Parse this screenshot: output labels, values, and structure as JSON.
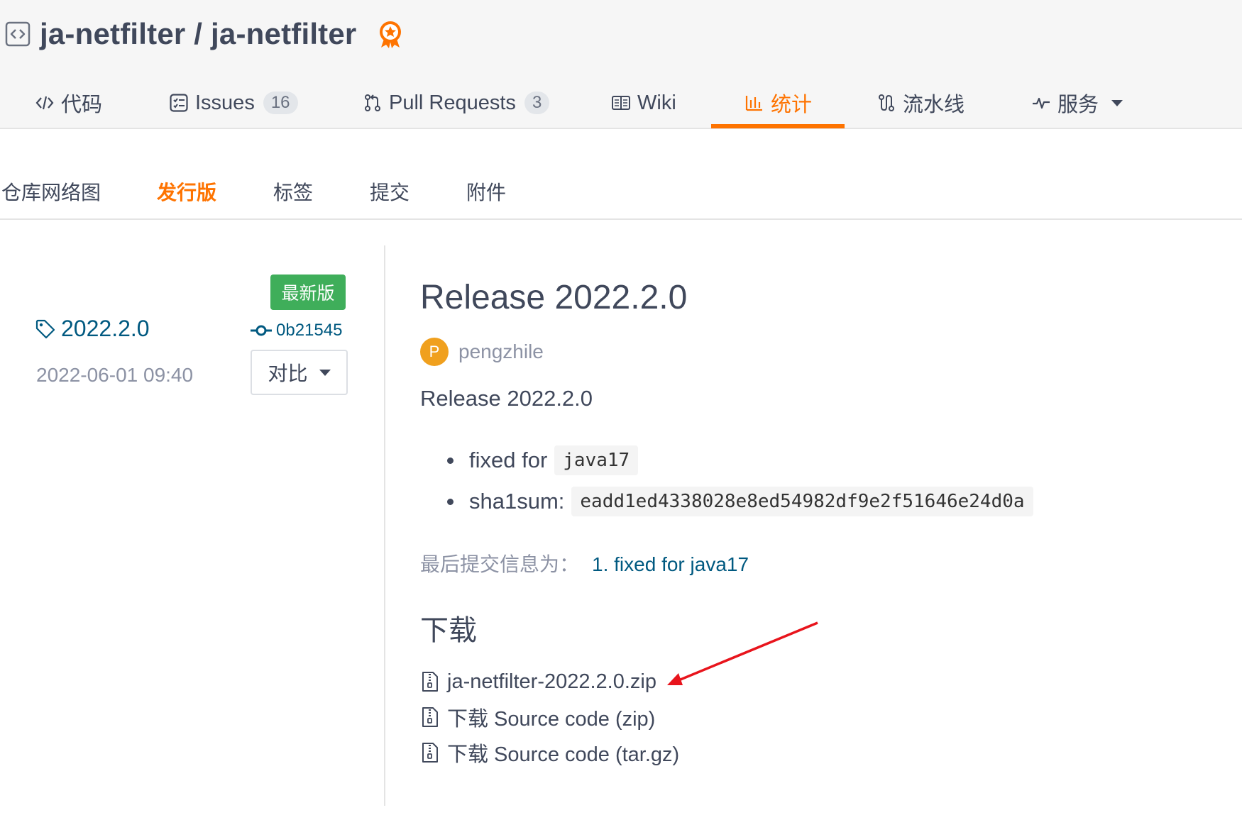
{
  "repo": {
    "owner": "ja-netfilter",
    "separator": " / ",
    "name": "ja-netfilter"
  },
  "main_tabs": [
    {
      "label": "代码",
      "icon": "code-icon"
    },
    {
      "label": "Issues",
      "count": "16",
      "icon": "issues-icon"
    },
    {
      "label": "Pull Requests",
      "count": "3",
      "icon": "pull-request-icon"
    },
    {
      "label": "Wiki",
      "icon": "wiki-icon"
    },
    {
      "label": "统计",
      "icon": "chart-icon",
      "active": true
    },
    {
      "label": "流水线",
      "icon": "pipeline-icon"
    },
    {
      "label": "服务",
      "icon": "pulse-icon"
    }
  ],
  "sub_tabs": [
    {
      "label": "仓库网络图"
    },
    {
      "label": "发行版",
      "active": true
    },
    {
      "label": "标签"
    },
    {
      "label": "提交"
    },
    {
      "label": "附件"
    }
  ],
  "sidebar": {
    "latest_badge": "最新版",
    "tag": "2022.2.0",
    "commit": "0b21545",
    "date": "2022-06-01 09:40",
    "compare_label": "对比"
  },
  "release": {
    "title": "Release 2022.2.0",
    "author_initial": "P",
    "author": "pengzhile",
    "description": "Release 2022.2.0",
    "notes": [
      {
        "text": "fixed for",
        "code": "java17"
      },
      {
        "text": "sha1sum:",
        "code": "eadd1ed4338028e8ed54982df9e2f51646e24d0a"
      }
    ],
    "last_commit_label": "最后提交信息为：",
    "last_commit_link": "1. fixed for java17"
  },
  "downloads": {
    "title": "下载",
    "items": [
      {
        "label": "ja-netfilter-2022.2.0.zip"
      },
      {
        "label": "下载 Source code (zip)"
      },
      {
        "label": "下载 Source code (tar.gz)"
      }
    ]
  },
  "colors": {
    "accent": "#fe7300",
    "link": "#005980",
    "latest_badge": "#3fae5a",
    "avatar": "#f0a01e",
    "annotation_arrow": "#e8141c"
  }
}
